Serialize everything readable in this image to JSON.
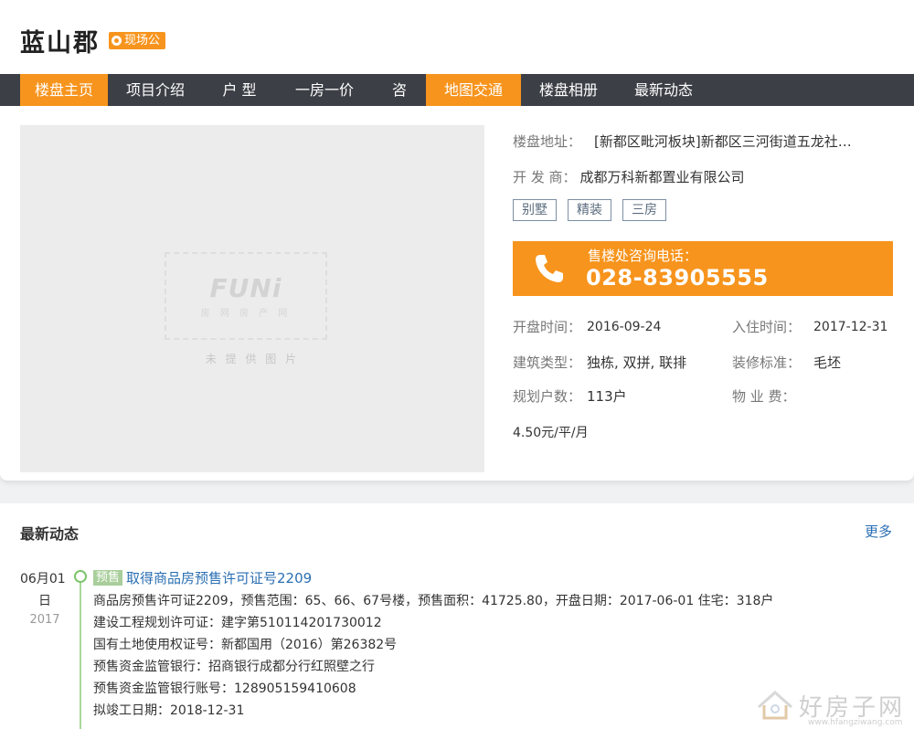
{
  "header": {
    "title": "蓝山郡",
    "badge": "现场公"
  },
  "nav": {
    "items": [
      "楼盘主页",
      "项目介绍",
      "户 型",
      "一房一价",
      "咨询",
      "地图交通",
      "楼盘相册",
      "最新动态"
    ]
  },
  "photo": {
    "logo": "FUNi",
    "logo_sub": "房 网 房 产 网",
    "caption": "未 提 供 图 片"
  },
  "info": {
    "address_label": "楼盘地址：",
    "address": "[新都区毗河板块]新都区三河街道五龙社…",
    "developer_label": "开 发 商：",
    "developer": "成都万科新都置业有限公司",
    "tags": [
      "别墅",
      "精装",
      "三房"
    ]
  },
  "phone": {
    "label": "售楼处咨询电话：",
    "number": "028-83905555"
  },
  "details": {
    "open_label": "开盘时间：",
    "open_value": "2016-09-24",
    "move_label": "入住时间：",
    "move_value": "2017-12-31",
    "type_label": "建筑类型：",
    "type_value": "独栋, 双拼, 联排",
    "decor_label": "装修标准：",
    "decor_value": "毛坯",
    "units_label": "规划户数：",
    "units_value": "113户",
    "fee_label": "物 业 费：",
    "fee_value": "4.50元/平/月"
  },
  "news": {
    "title": "最新动态",
    "more": "更多",
    "date_md": "06月01",
    "date_day": "日",
    "date_year": "2017",
    "tag": "预售",
    "headline": "取得商品房预售许可证号2209",
    "lines": [
      "商品房预售许可证2209，预售范围：65、66、67号楼，预售面积：41725.80，开盘日期：2017-06-01 住宅：318户",
      "建设工程规划许可证：建字第510114201730012",
      "国有土地使用权证号：新都国用（2016）第26382号",
      "预售资金监管银行：招商银行成都分行红照壁之行",
      "预售资金监管银行账号：128905159410608",
      "拟竣工日期：2018-12-31"
    ]
  },
  "watermark": {
    "text": "好房子网",
    "url": "www.hfangziwang.com"
  },
  "colors": {
    "accent": "#f7941d",
    "nav_bg": "#3c3f46",
    "link": "#2b6fb3",
    "timeline": "#7cc46b"
  }
}
